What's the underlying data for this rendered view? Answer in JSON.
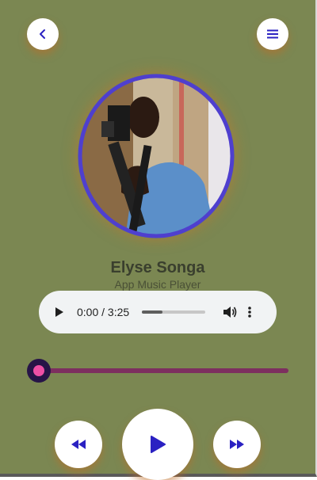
{
  "colors": {
    "background": "#7b8752",
    "accent": "#2a21c2",
    "ring": "#4f3fce",
    "progress_track": "#7d2f5f",
    "thumb_outer": "#271447",
    "thumb_inner": "#ee4fa5",
    "audio_bg": "#f1f3f4"
  },
  "header": {
    "back_icon": "chevron-left-icon",
    "menu_icon": "menu-icon"
  },
  "track": {
    "artist": "Elyse Songa",
    "subtitle": "App Music Player"
  },
  "audio_player": {
    "time": "0:00 / 3:25",
    "buffered_fraction": 0.33,
    "play_icon": "play-icon",
    "volume_icon": "volume-icon",
    "more_icon": "more-vertical-icon"
  },
  "progress": {
    "value": 0
  },
  "controls": {
    "prev_icon": "rewind-icon",
    "play_icon": "play-icon",
    "next_icon": "fast-forward-icon"
  }
}
